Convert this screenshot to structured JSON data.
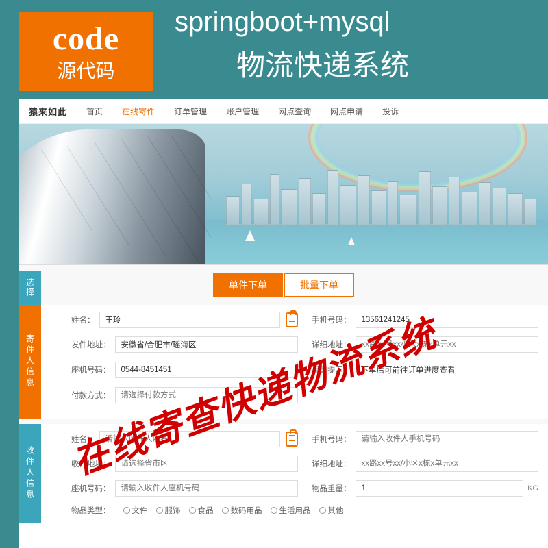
{
  "logo": {
    "main": "code",
    "sub": "源代码"
  },
  "header": {
    "line1": "springboot+mysql",
    "line2": "物流快递系统"
  },
  "brand": "猿来如此",
  "nav": {
    "items": [
      "首页",
      "在线寄件",
      "订单管理",
      "账户管理",
      "网点查询",
      "网点申请",
      "投诉"
    ],
    "active_index": 1
  },
  "tabs": {
    "side": "选择",
    "single": "单件下单",
    "batch": "批量下单"
  },
  "sender": {
    "label": "寄件人信息",
    "name_label": "姓名：",
    "name": "王玲",
    "phone_label": "手机号码：",
    "phone": "13561241245",
    "addr_label": "发件地址：",
    "addr": "安徽省/合肥市/瑶海区",
    "detail_label": "详细地址：",
    "detail_ph": "xx路xx号xx小区x栋x单元xx",
    "tel_label": "座机号码：",
    "tel": "0544-8451451",
    "remark_label": "温馨提示：",
    "remark_ph": "下单后可前往订单进度查看",
    "pay_label": "付款方式：",
    "pay_ph": "请选择付款方式"
  },
  "receiver": {
    "label": "收件人信息",
    "name_label": "姓名：",
    "name_ph": "请输入收件人姓名",
    "phone_label": "手机号码：",
    "phone_ph": "请输入收件人手机号码",
    "addr_label": "收件地址：",
    "addr_ph": "请选择省市区",
    "detail_label": "详细地址：",
    "detail_ph": "xx路xx号xx/小区x栋x单元xx",
    "tel_label": "座机号码：",
    "tel_ph": "请输入收件人座机号码",
    "weight_label": "物品重量：",
    "weight": "1",
    "weight_unit": "KG",
    "cat_label": "物品类型：",
    "categories": [
      "文件",
      "服饰",
      "食品",
      "数码用品",
      "生活用品",
      "其他"
    ]
  },
  "overlay": "在线寄查快递物流系统"
}
